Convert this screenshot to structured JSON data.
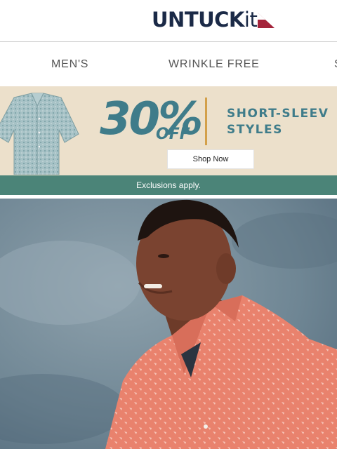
{
  "brand": {
    "name_main": "UNTUCK",
    "name_suffix": "it"
  },
  "nav": {
    "items": [
      "MEN'S",
      "WRINKLE FREE",
      "S"
    ]
  },
  "promo": {
    "percent": "30%",
    "off": "OFF",
    "headline_line1": "SHORT-SLEEV",
    "headline_line2": "STYLES",
    "cta_label": "Shop Now",
    "disclaimer": "Exclusions apply."
  },
  "colors": {
    "brand_navy": "#1b2a47",
    "brand_red": "#a4243b",
    "promo_teal": "#3f7c8a",
    "promo_bg": "#ece0cb",
    "banner_green": "#4b8478",
    "shirt_coral": "#e9826d"
  },
  "icons": {
    "logo_flag": "triangle-flag-icon",
    "promo_shirt": "shirt-icon"
  }
}
